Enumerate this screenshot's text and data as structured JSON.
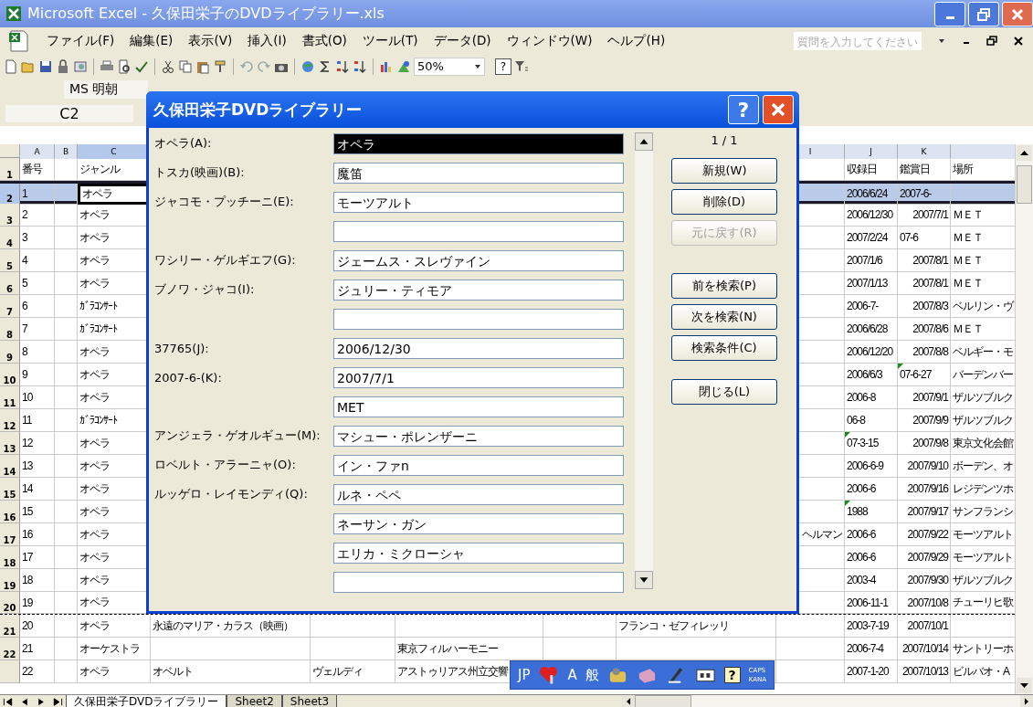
{
  "window": {
    "title": "Microsoft Excel - 久保田栄子のDVDライブラリー.xls"
  },
  "menu": [
    "ファイル(F)",
    "編集(E)",
    "表示(V)",
    "挿入(I)",
    "書式(O)",
    "ツール(T)",
    "データ(D)",
    "ウィンドウ(W)",
    "ヘルプ(H)"
  ],
  "help_search": {
    "placeholder": "質問を入力してください"
  },
  "toolbar": {
    "zoom": "50%",
    "help_symbol": "?"
  },
  "font_box": "MS 明朝",
  "name_box": "C2",
  "sheet": {
    "columns": [
      {
        "letter": "A",
        "selected": false
      },
      {
        "letter": "B",
        "selected": false
      },
      {
        "letter": "C",
        "selected": true
      },
      null,
      null,
      null,
      null,
      null,
      {
        "letter": "I",
        "selected": false
      },
      {
        "letter": "J",
        "selected": false
      },
      {
        "letter": "K",
        "selected": false
      },
      {
        "selected": false
      }
    ],
    "rows": [
      {
        "label": "1",
        "selected": false,
        "cells": [
          "番号",
          null,
          "ジャンル",
          null,
          null,
          null,
          null,
          null,
          null,
          "収録日",
          "鑑賞日",
          "場所"
        ]
      },
      {
        "label": "2",
        "selected": true,
        "cells": [
          "1",
          null,
          {
            "text": "オペラ",
            "active": true
          },
          null,
          null,
          null,
          null,
          null,
          null,
          "2006/6/24",
          "2007-6-",
          null
        ]
      },
      {
        "label": "3",
        "selected": false,
        "cells": [
          "2",
          null,
          "オペラ",
          null,
          null,
          null,
          null,
          null,
          null,
          "2006/12/30",
          {
            "text": "2007/7/1",
            "right_aligned": true
          },
          "ＭＥＴ"
        ]
      },
      {
        "label": "4",
        "selected": false,
        "cells": [
          "3",
          null,
          "オペラ",
          null,
          null,
          null,
          null,
          null,
          null,
          "2007/2/24",
          "07-6",
          "ＭＥＴ"
        ]
      },
      {
        "label": "5",
        "selected": false,
        "cells": [
          "4",
          null,
          "オペラ",
          null,
          null,
          null,
          null,
          null,
          null,
          "2007/1/6",
          {
            "text": "2007/8/1",
            "right_aligned": true
          },
          "ＭＥＴ"
        ]
      },
      {
        "label": "6",
        "selected": false,
        "cells": [
          "5",
          null,
          "オペラ",
          null,
          null,
          null,
          null,
          null,
          null,
          "2007/1/13",
          {
            "text": "2007/8/1",
            "right_aligned": true
          },
          "ＭＥＴ"
        ]
      },
      {
        "label": "7",
        "selected": false,
        "cells": [
          "6",
          null,
          "ｶﾞﾗｺﾝｻｰﾄ",
          null,
          null,
          null,
          null,
          null,
          null,
          "2006-7-",
          {
            "text": "2007/8/3",
            "right_aligned": true
          },
          "ベルリン・ヴ"
        ]
      },
      {
        "label": "8",
        "selected": false,
        "cells": [
          "7",
          null,
          "ｶﾞﾗｺﾝｻｰﾄ",
          null,
          null,
          null,
          null,
          null,
          null,
          "2006/6/28",
          {
            "text": "2007/8/6",
            "right_aligned": true
          },
          "ＭＥＴ"
        ]
      },
      {
        "label": "9",
        "selected": false,
        "cells": [
          "8",
          null,
          "オペラ",
          null,
          null,
          null,
          null,
          null,
          null,
          "2006/12/20",
          {
            "text": "2007/8/8",
            "right_aligned": true
          },
          "ベルギー・モ"
        ]
      },
      {
        "label": "10",
        "selected": false,
        "cells": [
          "9",
          null,
          "オペラ",
          null,
          null,
          null,
          null,
          null,
          null,
          "2006/6/3",
          {
            "text": "07-6-27",
            "flag": true
          },
          "バーデンバー"
        ]
      },
      {
        "label": "11",
        "selected": false,
        "cells": [
          "10",
          null,
          "オペラ",
          null,
          null,
          null,
          null,
          null,
          null,
          "2006-8",
          {
            "text": "2007/9/1",
            "right_aligned": true
          },
          "ザルツブルク"
        ]
      },
      {
        "label": "12",
        "selected": false,
        "cells": [
          "11",
          null,
          "ｶﾞﾗｺﾝｻｰﾄ",
          null,
          null,
          null,
          null,
          null,
          null,
          "06-8",
          {
            "text": "2007/9/9",
            "right_aligned": true
          },
          "ザルツブルク"
        ]
      },
      {
        "label": "13",
        "selected": false,
        "cells": [
          "12",
          null,
          "オペラ",
          null,
          null,
          null,
          null,
          null,
          null,
          {
            "text": "07-3-15",
            "flag": true
          },
          {
            "text": "2007/9/8",
            "right_aligned": true
          },
          "東京文化会館"
        ]
      },
      {
        "label": "14",
        "selected": false,
        "cells": [
          "13",
          null,
          "オペラ",
          null,
          null,
          null,
          null,
          null,
          null,
          "2006-6-9",
          {
            "text": "2007/9/10",
            "right_aligned": true
          },
          "ボーデン、オ"
        ]
      },
      {
        "label": "15",
        "selected": false,
        "cells": [
          "14",
          null,
          "オペラ",
          null,
          null,
          null,
          null,
          null,
          null,
          "2006-6",
          {
            "text": "2007/9/16",
            "right_aligned": true
          },
          "レジデンツホ"
        ]
      },
      {
        "label": "16",
        "selected": false,
        "cells": [
          "15",
          null,
          "オペラ",
          null,
          null,
          null,
          null,
          null,
          null,
          {
            "text": "1988",
            "flag": true
          },
          {
            "text": "2007/9/17",
            "right_aligned": true
          },
          "サンフランシ"
        ]
      },
      {
        "label": "17",
        "selected": false,
        "cells": [
          "16",
          null,
          "オペラ",
          null,
          null,
          null,
          null,
          null,
          {
            "text": "ヘルマン",
            "right_aligned": true
          },
          "2006-6",
          {
            "text": "2007/9/22",
            "right_aligned": true
          },
          "モーツアルト"
        ]
      },
      {
        "label": "18",
        "selected": false,
        "cells": [
          "17",
          null,
          "オペラ",
          null,
          null,
          null,
          null,
          null,
          null,
          "2006-6",
          {
            "text": "2007/9/29",
            "right_aligned": true
          },
          "モーツアルト"
        ]
      },
      {
        "label": "19",
        "selected": false,
        "cells": [
          "18",
          null,
          "オペラ",
          null,
          null,
          null,
          null,
          null,
          null,
          "2003-4",
          {
            "text": "2007/9/30",
            "right_aligned": true
          },
          "ザルツブルク"
        ]
      },
      {
        "label": "20",
        "selected": false,
        "page_break_after": true,
        "cells": [
          "19",
          null,
          "オペラ",
          null,
          null,
          null,
          null,
          null,
          null,
          "2006-11-1",
          {
            "text": "2007/10/8",
            "right_aligned": true
          },
          "チューリヒ歌"
        ]
      },
      {
        "label": "21",
        "selected": false,
        "cells": [
          "20",
          null,
          "オペラ",
          "永遠のマリア・カラス（映画）",
          null,
          null,
          null,
          "フランコ・ゼフィレッリ",
          null,
          "2003-7-19",
          {
            "text": "2007/10/1",
            "right_aligned": true
          },
          null
        ]
      },
      {
        "label": "22",
        "selected": false,
        "cells": [
          "21",
          null,
          "オーケストラ",
          null,
          null,
          "東京フィルハーモニー",
          null,
          null,
          null,
          "2006-7-4",
          {
            "text": "2007/10/14",
            "right_aligned": true
          },
          "サントリーホ"
        ]
      },
      {
        "selected": false,
        "cells": [
          "22",
          null,
          "オペラ",
          "オベルト",
          "ヴェルディ",
          "アストゥリアス州立交響",
          null,
          null,
          null,
          "2007-1-20",
          {
            "text": "2007/10/13",
            "right_aligned": true
          },
          "ビルバオ・A"
        ]
      }
    ]
  },
  "dialog": {
    "title": "久保田栄子DVDライブラリー",
    "help": "?",
    "record": "1 / 1",
    "fields": [
      {
        "label": "オペラ(A):",
        "value": "オペラ",
        "selected": true
      },
      {
        "label": "トスカ(映画)(B):",
        "value": "魔笛",
        "selected": false
      },
      {
        "label": "ジャコモ・プッチーニ(E):",
        "value": "モーツアルト",
        "selected": false
      },
      {
        "selected": false
      },
      {
        "label": "ワシリー・ゲルギエフ(G):",
        "value": "ジェームス・スレヴァイン",
        "selected": false
      },
      {
        "label": "ブノワ・ジャコ(I):",
        "value": "ジュリー・ティモア",
        "selected": false
      },
      {
        "selected": false
      },
      {
        "label": "37765(J):",
        "value": "2006/12/30",
        "selected": false
      },
      {
        "label": "2007-6-(K):",
        "value": "2007/7/1",
        "selected": false
      },
      {
        "value": "MET",
        "selected": false
      },
      {
        "label": "アンジェラ・ゲオルギュー(M):",
        "value": "マシュー・ポレンザーニ",
        "selected": false
      },
      {
        "label": "ロベルト・アラーニャ(O):",
        "value": "イン・ファn",
        "selected": false
      },
      {
        "label": "ルッゲロ・レイモンディ(Q):",
        "value": "ルネ・ペペ",
        "selected": false
      },
      {
        "value": "ネーサン・ガン",
        "selected": false
      },
      {
        "value": "エリカ・ミクローシャ",
        "selected": false
      },
      {
        "selected": false
      }
    ],
    "buttons": [
      {
        "label": "新規(W)",
        "disabled": false
      },
      {
        "label": "削除(D)",
        "disabled": false
      },
      {
        "label": "元に戻す(R)",
        "disabled": true
      },
      {
        "label": "前を検索(P)",
        "disabled": false
      },
      {
        "label": "次を検索(N)",
        "disabled": false
      },
      {
        "label": "検索条件(C)",
        "disabled": false
      },
      {
        "label": "閉じる(L)",
        "disabled": false
      }
    ]
  },
  "sheet_tabs": [
    {
      "label": "久保田栄子DVDライブラリー",
      "selected": true
    },
    {
      "label": "Sheet2",
      "selected": false
    },
    {
      "label": "Sheet3",
      "selected": false
    }
  ],
  "ime_bar": {
    "language": "JP",
    "input_mode": "A",
    "dictionary": "般",
    "help": "?",
    "caps": "CAPS",
    "kana": "KANA"
  }
}
